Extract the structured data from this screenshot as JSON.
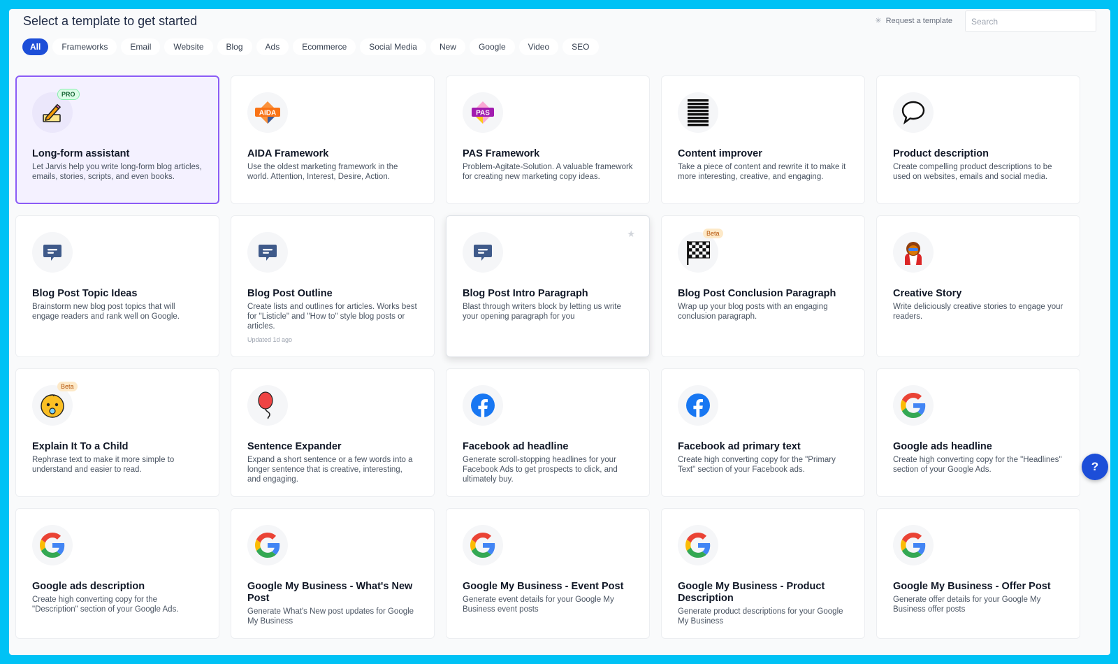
{
  "header": {
    "title": "Select a template to get started",
    "request_label": "Request a template",
    "search_placeholder": "Search"
  },
  "filters": [
    "All",
    "Frameworks",
    "Email",
    "Website",
    "Blog",
    "Ads",
    "Ecommerce",
    "Social Media",
    "New",
    "Google",
    "Video",
    "SEO"
  ],
  "active_filter": "All",
  "cards": [
    {
      "title": "Long-form assistant",
      "desc": "Let Jarvis help you write long-form blog articles, emails, stories, scripts, and even books.",
      "icon": "pencil-writing-icon",
      "badge": "PRO"
    },
    {
      "title": "AIDA Framework",
      "desc": "Use the oldest marketing framework in the world. Attention, Interest, Desire, Action.",
      "icon": "aida-icon",
      "icon_text": "AIDA"
    },
    {
      "title": "PAS Framework",
      "desc": "Problem-Agitate-Solution. A valuable framework for creating new marketing copy ideas.",
      "icon": "pas-icon",
      "icon_text": "PAS"
    },
    {
      "title": "Content improver",
      "desc": "Take a piece of content and rewrite it to make it more interesting, creative, and engaging.",
      "icon": "lines-icon"
    },
    {
      "title": "Product description",
      "desc": "Create compelling product descriptions to be used on websites, emails and social media.",
      "icon": "speech-bubble-icon"
    },
    {
      "title": "Blog Post Topic Ideas",
      "desc": "Brainstorm new blog post topics that will engage readers and rank well on Google.",
      "icon": "chat-icon"
    },
    {
      "title": "Blog Post Outline",
      "desc": "Create lists and outlines for articles. Works best for \"Listicle\" and \"How to\" style blog posts or articles.",
      "icon": "chat-icon",
      "meta": "Updated 1d ago"
    },
    {
      "title": "Blog Post Intro Paragraph",
      "desc": "Blast through writers block by letting us write your opening paragraph for you",
      "icon": "chat-icon",
      "star": true
    },
    {
      "title": "Blog Post Conclusion Paragraph",
      "desc": "Wrap up your blog posts with an engaging conclusion paragraph.",
      "icon": "checkered-flag-icon",
      "badge": "Beta"
    },
    {
      "title": "Creative Story",
      "desc": "Write deliciously creative stories to engage your readers.",
      "icon": "superhero-icon"
    },
    {
      "title": "Explain It To a Child",
      "desc": "Rephrase text to make it more simple to understand and easier to read.",
      "icon": "baby-icon",
      "badge": "Beta"
    },
    {
      "title": "Sentence Expander",
      "desc": "Expand a short sentence or a few words into a longer sentence that is creative, interesting, and engaging.",
      "icon": "balloon-icon"
    },
    {
      "title": "Facebook ad headline",
      "desc": "Generate scroll-stopping headlines for your Facebook Ads to get prospects to click, and ultimately buy.",
      "icon": "facebook-icon"
    },
    {
      "title": "Facebook ad primary text",
      "desc": "Create high converting copy for the \"Primary Text\" section of your Facebook ads.",
      "icon": "facebook-icon"
    },
    {
      "title": "Google ads headline",
      "desc": "Create high converting copy for the \"Headlines\" section of your Google Ads.",
      "icon": "google-icon"
    },
    {
      "title": "Google ads description",
      "desc": "Create high converting copy for the \"Description\" section of your Google Ads.",
      "icon": "google-icon"
    },
    {
      "title": "Google My Business - What's New Post",
      "desc": "Generate What's New post updates for Google My Business",
      "icon": "google-icon"
    },
    {
      "title": "Google My Business - Event Post",
      "desc": "Generate event details for your Google My Business event posts",
      "icon": "google-icon"
    },
    {
      "title": "Google My Business - Product Description",
      "desc": "Generate product descriptions for your Google My Business",
      "icon": "google-icon"
    },
    {
      "title": "Google My Business - Offer Post",
      "desc": "Generate offer details for your Google My Business offer posts",
      "icon": "google-icon"
    }
  ],
  "help_label": "?",
  "colors": {
    "accent": "#1d4ed8",
    "selected_border": "#8b5cf6",
    "background": "#00c2f5"
  }
}
